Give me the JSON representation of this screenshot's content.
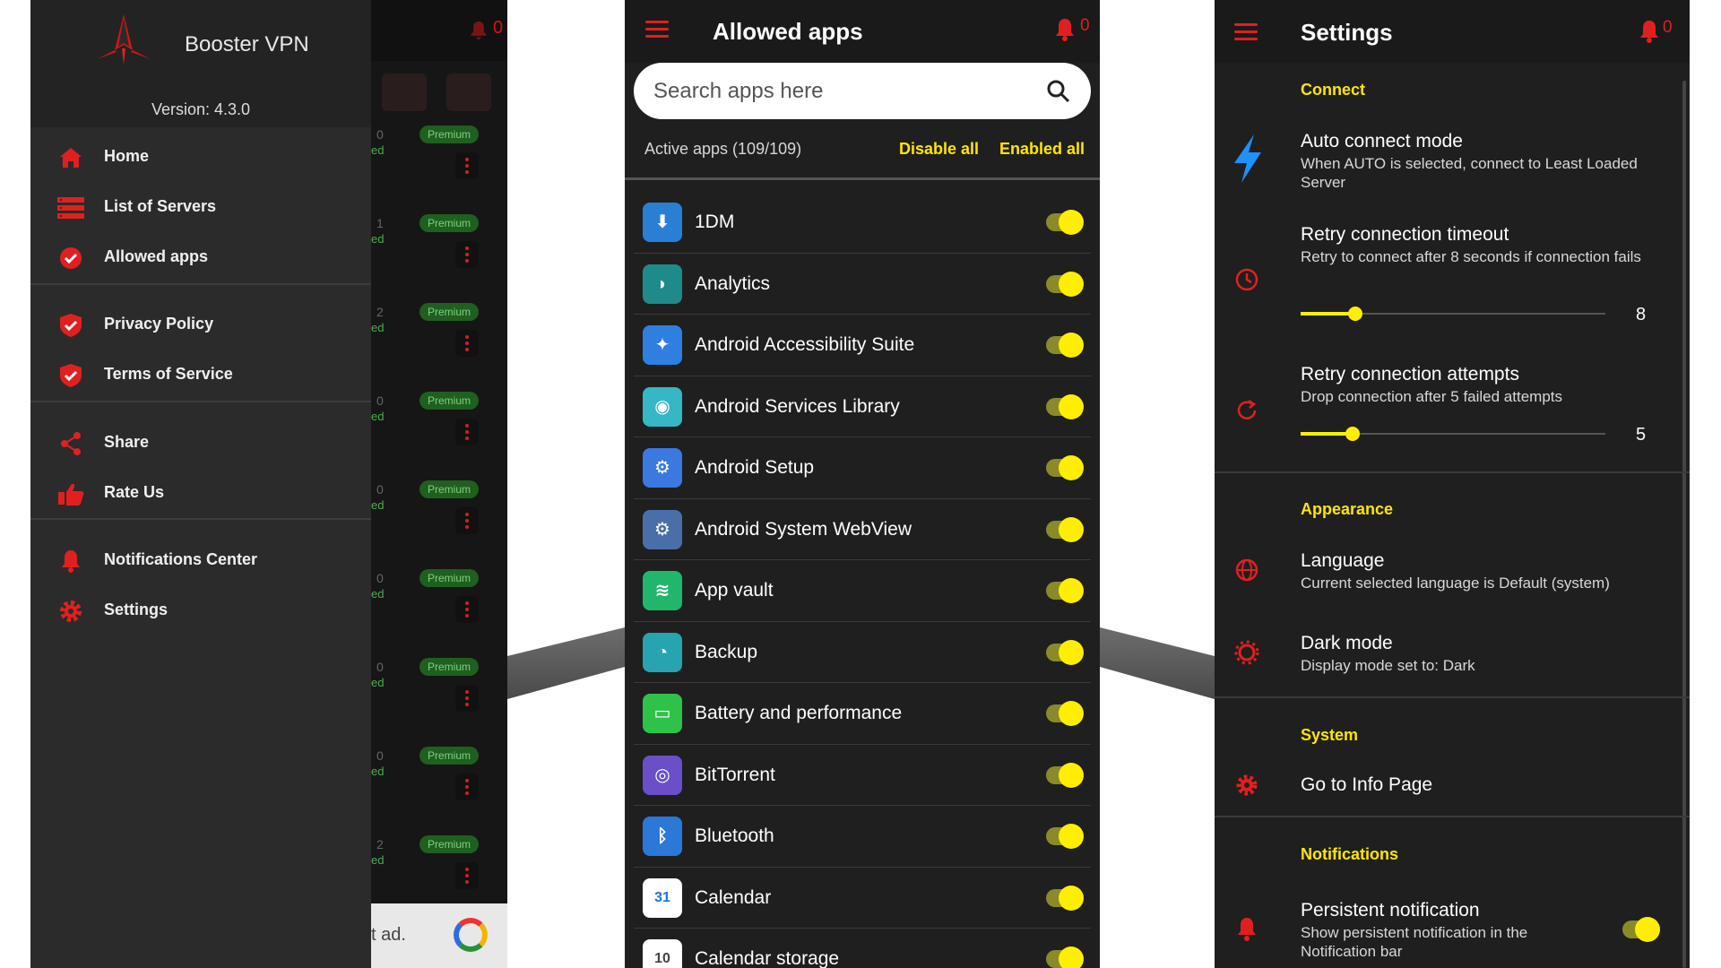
{
  "colors": {
    "accent_red": "#e02020",
    "accent_yellow": "#ffe600",
    "panel_dark": "#1f1f1f",
    "drawer_bg": "#2b2b2b"
  },
  "drawer": {
    "app_name": "Booster VPN",
    "version": "Version: 4.3.0",
    "items": [
      {
        "label": "Home",
        "icon": "home-icon"
      },
      {
        "label": "List of Servers",
        "icon": "server-list-icon"
      },
      {
        "label": "Allowed apps",
        "icon": "check-circle-icon"
      },
      {
        "label": "Privacy Policy",
        "icon": "shield-check-icon"
      },
      {
        "label": "Terms of Service",
        "icon": "shield-check-icon"
      },
      {
        "label": "Share",
        "icon": "share-icon"
      },
      {
        "label": "Rate Us",
        "icon": "thumbs-up-icon"
      },
      {
        "label": "Notifications Center",
        "icon": "bell-icon"
      },
      {
        "label": "Settings",
        "icon": "gear-icon"
      }
    ],
    "background": {
      "notification_count": "0",
      "premium_badge": "Premium",
      "row_numbers": [
        "0",
        "1",
        "2",
        "0",
        "0",
        "0",
        "0",
        "0",
        "2"
      ],
      "row_suffix": "ed",
      "ad_text": "t ad."
    }
  },
  "allowed_apps": {
    "title": "Allowed apps",
    "notification_count": "0",
    "search_placeholder": "Search apps here",
    "active_count": "Active apps (109/109)",
    "disable_all": "Disable all",
    "enable_all": "Enabled all",
    "apps": [
      {
        "name": "1DM",
        "icon_color": "#2a7fd4",
        "glyph": "⬇",
        "enabled": true
      },
      {
        "name": "Analytics",
        "icon_color": "#1f8a8a",
        "glyph": "◗",
        "enabled": true
      },
      {
        "name": "Android Accessibility Suite",
        "icon_color": "#2f7fe0",
        "glyph": "✦",
        "enabled": true
      },
      {
        "name": "Android Services Library",
        "icon_color": "#35b7c4",
        "glyph": "◉",
        "enabled": true
      },
      {
        "name": "Android Setup",
        "icon_color": "#3b78e0",
        "glyph": "⚙",
        "enabled": true
      },
      {
        "name": "Android System WebView",
        "icon_color": "#4a6fa8",
        "glyph": "⚙",
        "enabled": true
      },
      {
        "name": "App vault",
        "icon_color": "#21b66b",
        "glyph": "≋",
        "enabled": true
      },
      {
        "name": "Backup",
        "icon_color": "#27a4b0",
        "glyph": "◔",
        "enabled": true
      },
      {
        "name": "Battery and performance",
        "icon_color": "#2fc24a",
        "glyph": "▭",
        "enabled": true
      },
      {
        "name": "BitTorrent",
        "icon_color": "#6a4fc9",
        "glyph": "◎",
        "enabled": true
      },
      {
        "name": "Bluetooth",
        "icon_color": "#2b78d8",
        "glyph": "ᛒ",
        "enabled": true
      },
      {
        "name": "Calendar",
        "icon_color": "#ffffff",
        "glyph": "31",
        "enabled": true
      },
      {
        "name": "Calendar storage",
        "icon_color": "#ffffff",
        "glyph": "10",
        "enabled": true
      }
    ]
  },
  "settings": {
    "title": "Settings",
    "notification_count": "0",
    "sections": {
      "connect": "Connect",
      "appearance": "Appearance",
      "system": "System",
      "notifications": "Notifications"
    },
    "auto_connect": {
      "title": "Auto connect mode",
      "subtitle": "When AUTO is selected, connect to Least Loaded Server"
    },
    "retry_timeout": {
      "title": "Retry connection timeout",
      "subtitle": "Retry to connect after 8 seconds if connection fails",
      "value": "8",
      "fraction": 0.18
    },
    "retry_attempts": {
      "title": "Retry connection attempts",
      "subtitle": "Drop connection after 5 failed attempts",
      "value": "5",
      "fraction": 0.17
    },
    "language": {
      "title": "Language",
      "subtitle": "Current selected language is Default (system)"
    },
    "dark_mode": {
      "title": "Dark mode",
      "subtitle": "Display mode set to: Dark"
    },
    "info_page": {
      "title": "Go to Info Page"
    },
    "persistent": {
      "title": "Persistent notification",
      "subtitle": "Show persistent notification in the Notification bar",
      "enabled": true
    }
  }
}
